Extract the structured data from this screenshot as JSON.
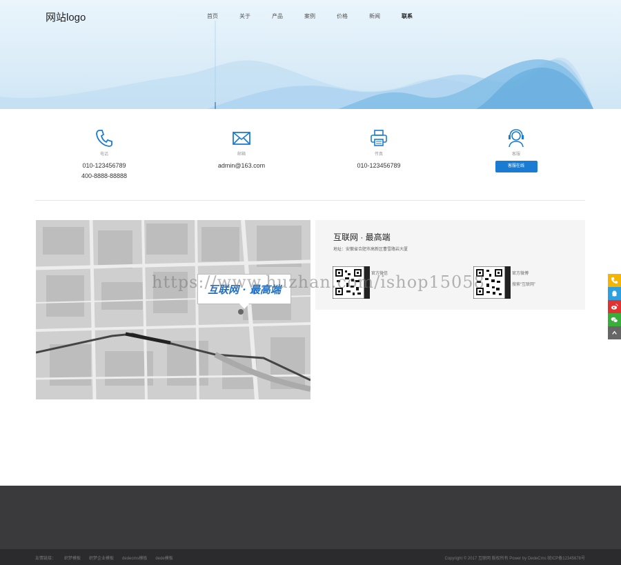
{
  "header": {
    "logo": "网站logo",
    "nav": [
      {
        "label": "首页",
        "active": false
      },
      {
        "label": "关于",
        "active": false
      },
      {
        "label": "产品",
        "active": false
      },
      {
        "label": "案例",
        "active": false
      },
      {
        "label": "价格",
        "active": false
      },
      {
        "label": "新闻",
        "active": false
      },
      {
        "label": "联系",
        "active": true
      }
    ]
  },
  "contact": {
    "phone": {
      "icon": "phone-icon",
      "label": "电话",
      "values": [
        "010-123456789",
        "400-8888-88888"
      ]
    },
    "email": {
      "icon": "mail-icon",
      "label": "邮箱",
      "value": "admin@163.com"
    },
    "fax": {
      "icon": "printer-icon",
      "label": "传真",
      "value": "010-123456789"
    },
    "service": {
      "icon": "headset-icon",
      "label": "客服",
      "button": "客服在线"
    }
  },
  "map": {
    "tag": "互联网 · 最高端"
  },
  "info": {
    "title": "互联网 · 最高端",
    "address": "地址：安徽省合肥市高新区曹雪路岩大厦",
    "qr": [
      {
        "label": "官方微信",
        "sub": ""
      },
      {
        "label": "官方微博",
        "sub": "搜索“互联网”"
      }
    ]
  },
  "watermark": "https://www.huzhan.com/ishop15058",
  "side": [
    "phone-icon",
    "qq-icon",
    "weibo-icon",
    "wechat-icon",
    "top-icon"
  ],
  "footer": {
    "links": [
      "友情链接：",
      "织梦模板",
      "织梦企业模板",
      "dedecms模板",
      "dede模板"
    ],
    "copyright": "Copyright © 2017 互联网 版权所有 Power by DedeCms 皖ICP备12345678号"
  },
  "colors": {
    "accent": "#1a7bd2",
    "footer": "#3a3a3c",
    "wave": "#7fbde6"
  }
}
